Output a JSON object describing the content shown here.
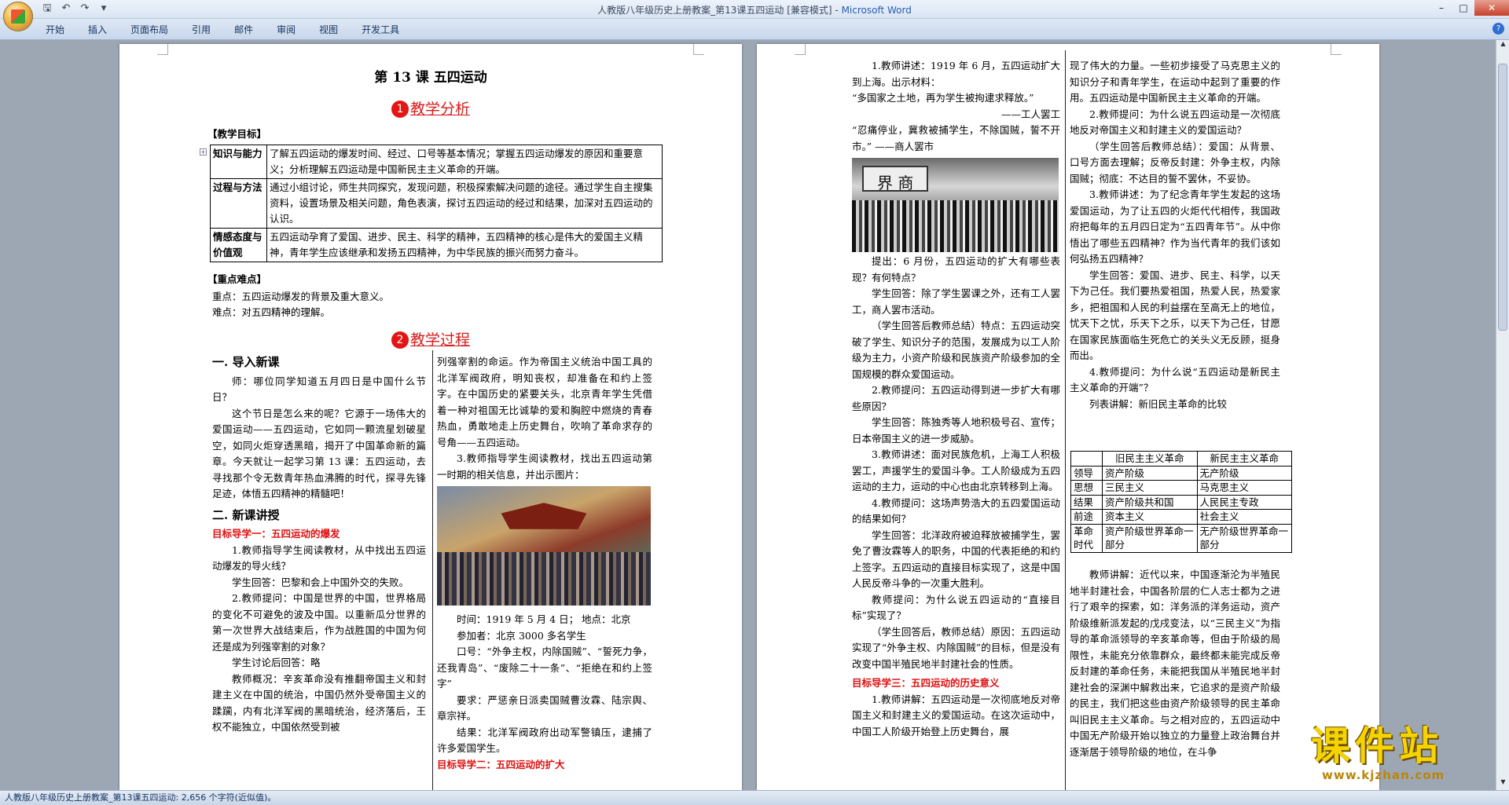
{
  "window": {
    "title": "人教版八年级历史上册教案_第13课五四运动 [兼容模式] - ",
    "app_name": "Microsoft Word"
  },
  "qat": {
    "save_icon": "save-icon",
    "undo_icon": "undo-icon",
    "redo_icon": "redo-icon"
  },
  "ribbon": {
    "tabs": [
      "开始",
      "插入",
      "页面布局",
      "引用",
      "邮件",
      "审阅",
      "视图",
      "开发工具"
    ]
  },
  "statusbar": {
    "text": "人教版八年级历史上册教案_第13课五四运动: 2,656 个字符(近似值)。"
  },
  "watermark": {
    "cn": "课件站",
    "url": "www.kjzhan.com"
  },
  "page1": {
    "title": "第 13 课    五四运动",
    "h1": {
      "num": "1",
      "text": "教学分析"
    },
    "goals_label": "【教学目标】",
    "goals": [
      {
        "k": "知识与能力",
        "v": "了解五四运动的爆发时间、经过、口号等基本情况；掌握五四运动爆发的原因和重要意义；分析理解五四运动是中国新民主主义革命的开端。"
      },
      {
        "k": "过程与方法",
        "v": "通过小组讨论，师生共同探究，发现问题，积极探索解决问题的途径。通过学生自主搜集资料，设置场景及相关问题，角色表演，探讨五四运动的经过和结果，加深对五四运动的认识。"
      },
      {
        "k": "情感态度与价值观",
        "v": "五四运动孕育了爱国、进步、民主、科学的精神，五四精神的核心是伟大的爱国主义精神，青年学生应该继承和发扬五四精神，为中华民族的振兴而努力奋斗。"
      }
    ],
    "key_label": "【重点难点】",
    "key": "重点：五四运动爆发的背景及重大意义。",
    "diff": "难点：对五四精神的理解。",
    "h2": {
      "num": "2",
      "text": "教学过程"
    },
    "sec1": "一. 导入新课",
    "left_col": [
      "师：哪位同学知道五月四日是中国什么节日？",
      "这个节日是怎么来的呢？它源于一场伟大的爱国运动——五四运动，它如同一颗流星划破星空，如同火炬穿透黑暗，揭开了中国革命新的篇章。今天就让一起学习第 13 课：五四运动，去寻找那个令无数青年热血沸腾的时代，探寻先锋足迹，体悟五四精神的精髓吧！"
    ],
    "sec2": "二. 新课讲授",
    "goal1": "目标导学一：五四运动的爆发",
    "left_col2": [
      "1.教师指导学生阅读教材，从中找出五四运动爆发的导火线？",
      "学生回答：巴黎和会上中国外交的失败。",
      "2.教师提问：中国是世界的中国，世界格局的变化不可避免的波及中国。以重新瓜分世界的第一次世界大战结束后，作为战胜国的中国为何还是成为列强宰割的对象？",
      "学生讨论后回答：略",
      "教师概况：辛亥革命没有推翻帝国主义和封建主义在中国的统治，中国仍然外受帝国主义的蹂躏，内有北洋军阀的黑暗统治，经济落后，王权不能独立，中国依然受到被"
    ],
    "right_col": [
      "列强宰割的命运。作为帝国主义统治中国工具的北洋军阀政府，明知丧权，却准备在和约上签字。在中国历史的紧要关头，北京青年学生凭借着一种对祖国无比诚挚的爱和胸腔中燃烧的青春热血，勇敢地走上历史舞台，吹响了革命求存的号角——五四运动。",
      "3.教师指导学生阅读教材，找出五四运动第一时期的相关信息，并出示图片："
    ],
    "right_col2": [
      "时间：1919 年 5 月 4 日；    地点：北京",
      "参加者：北京 3000 多名学生",
      "口号：“外争主权，内除国贼”、“誓死力争，还我青岛”、“废除二十一条”、“拒绝在和约上签字”",
      "要求：严惩亲日派卖国贼曹汝霖、陆宗舆、章宗祥。",
      "结果：北洋军阀政府出动军警镇压，逮捕了许多爱国学生。"
    ],
    "goal2": "目标导学二：五四运动的扩大"
  },
  "page2": {
    "left_col": [
      "1.教师讲述：1919 年 6 月，五四运动扩大到上海。出示材料：",
      "“多国家之土地，再为学生被拘逮求释放。”",
      "——工人罢工",
      "“忍痛停业，冀救被捕学生，不除国贼，誓不开市。”                ——商人罢市"
    ],
    "left_col2": [
      "提出：6 月份，五四运动的扩大有哪些表现？有何特点？",
      "学生回答：除了学生罢课之外，还有工人罢工，商人罢市活动。",
      "（学生回答后教师总结）特点：五四运动突破了学生、知识分子的范围，发展成为以工人阶级为主力，小资产阶级和民族资产阶级参加的全国规模的群众爱国运动。",
      "2.教师提问：五四运动得到进一步扩大有哪些原因？",
      "学生回答：陈独秀等人地积极号召、宣传；日本帝国主义的进一步威胁。",
      "3.教师讲述：面对民族危机，上海工人积极罢工，声援学生的爱国斗争。工人阶级成为五四运动的主力，运动的中心也由北京转移到上海。",
      "4.教师提问：这场声势浩大的五四爱国运动的结果如何？",
      "学生回答：北洋政府被迫释放被捕学生，罢免了曹汝霖等人的职务，中国的代表拒绝的和约上签字。五四运动的直接目标实现了，这是中国人民反帝斗争的一次重大胜利。",
      "教师提问：为什么说五四运动的“直接目标”实现了？",
      "（学生回答后，教师总结）原因：五四运动实现了“外争主权、内除国贼”的目标，但是没有改变中国半殖民地半封建社会的性质。"
    ],
    "goal3": "目标导学三：五四运动的历史意义",
    "left_col3": [
      "1.教师讲解：五四运动是一次彻底地反对帝国主义和封建主义的爱国运动。在这次运动中，中国工人阶级开始登上历史舞台，展"
    ],
    "right_col": [
      "现了伟大的力量。一些初步接受了马克思主义的知识分子和青年学生，在运动中起到了重要的作用。五四运动是中国新民主主义革命的开端。",
      "2.教师提问：为什么说五四运动是一次彻底地反对帝国主义和封建主义的爱国运动？",
      "（学生回答后教师总结）：爱国：从背景、口号方面去理解；反帝反封建：外争主权，内除国贼；彻底：不达目的誓不罢休，不妥协。",
      "3.教师讲述：为了纪念青年学生发起的这场爱国运动，为了让五四的火炬代代相传，我国政府把每年的五月四日定为“五四青年节”。从中你悟出了哪些五四精神？作为当代青年的我们该如何弘扬五四精神？",
      "学生回答：爱国、进步、民主、科学，以天下为己任。我们要热爱祖国，热爱人民，热爱家乡，把祖国和人民的利益摆在至高无上的地位，忧天下之忧，乐天下之乐，以天下为己任，甘愿在国家民族面临生死危亡的关头义无反顾，挺身而出。",
      "4.教师提问：为什么说“五四运动是新民主主义革命的开端”？",
      "列表讲解：新旧民主革命的比较"
    ],
    "table": {
      "header": [
        "",
        "旧民主主义革命",
        "新民主主义革命"
      ],
      "rows": [
        [
          "领导",
          "资产阶级",
          "无产阶级"
        ],
        [
          "思想",
          "三民主义",
          "马克思主义"
        ],
        [
          "结果",
          "资产阶级共和国",
          "人民民主专政"
        ],
        [
          "前途",
          "资本主义",
          "社会主义"
        ],
        [
          "革命时代",
          "资产阶级世界革命一部分",
          "无产阶级世界革命一部分"
        ]
      ]
    },
    "right_col2": [
      "教师讲解：近代以来，中国逐渐沦为半殖民地半封建社会，中国各阶层的仁人志士都为之进行了艰辛的探索，如：洋务派的洋务运动，资产阶级维新派发起的戊戌变法，以“三民主义”为指导的革命派领导的辛亥革命等，但由于阶级的局限性，未能充分依靠群众，最终都未能完成反帝反封建的革命任务，未能把我国从半殖民地半封建社会的深渊中解救出来，它追求的是资产阶级的民主，我们把这些由资产阶级领导的民主革命叫旧民主主义革命。与之相对应的，五四运动中中国无产阶级开始以独立的力量登上政治舞台并逐渐居于领导阶级的地位，在斗争"
    ]
  }
}
